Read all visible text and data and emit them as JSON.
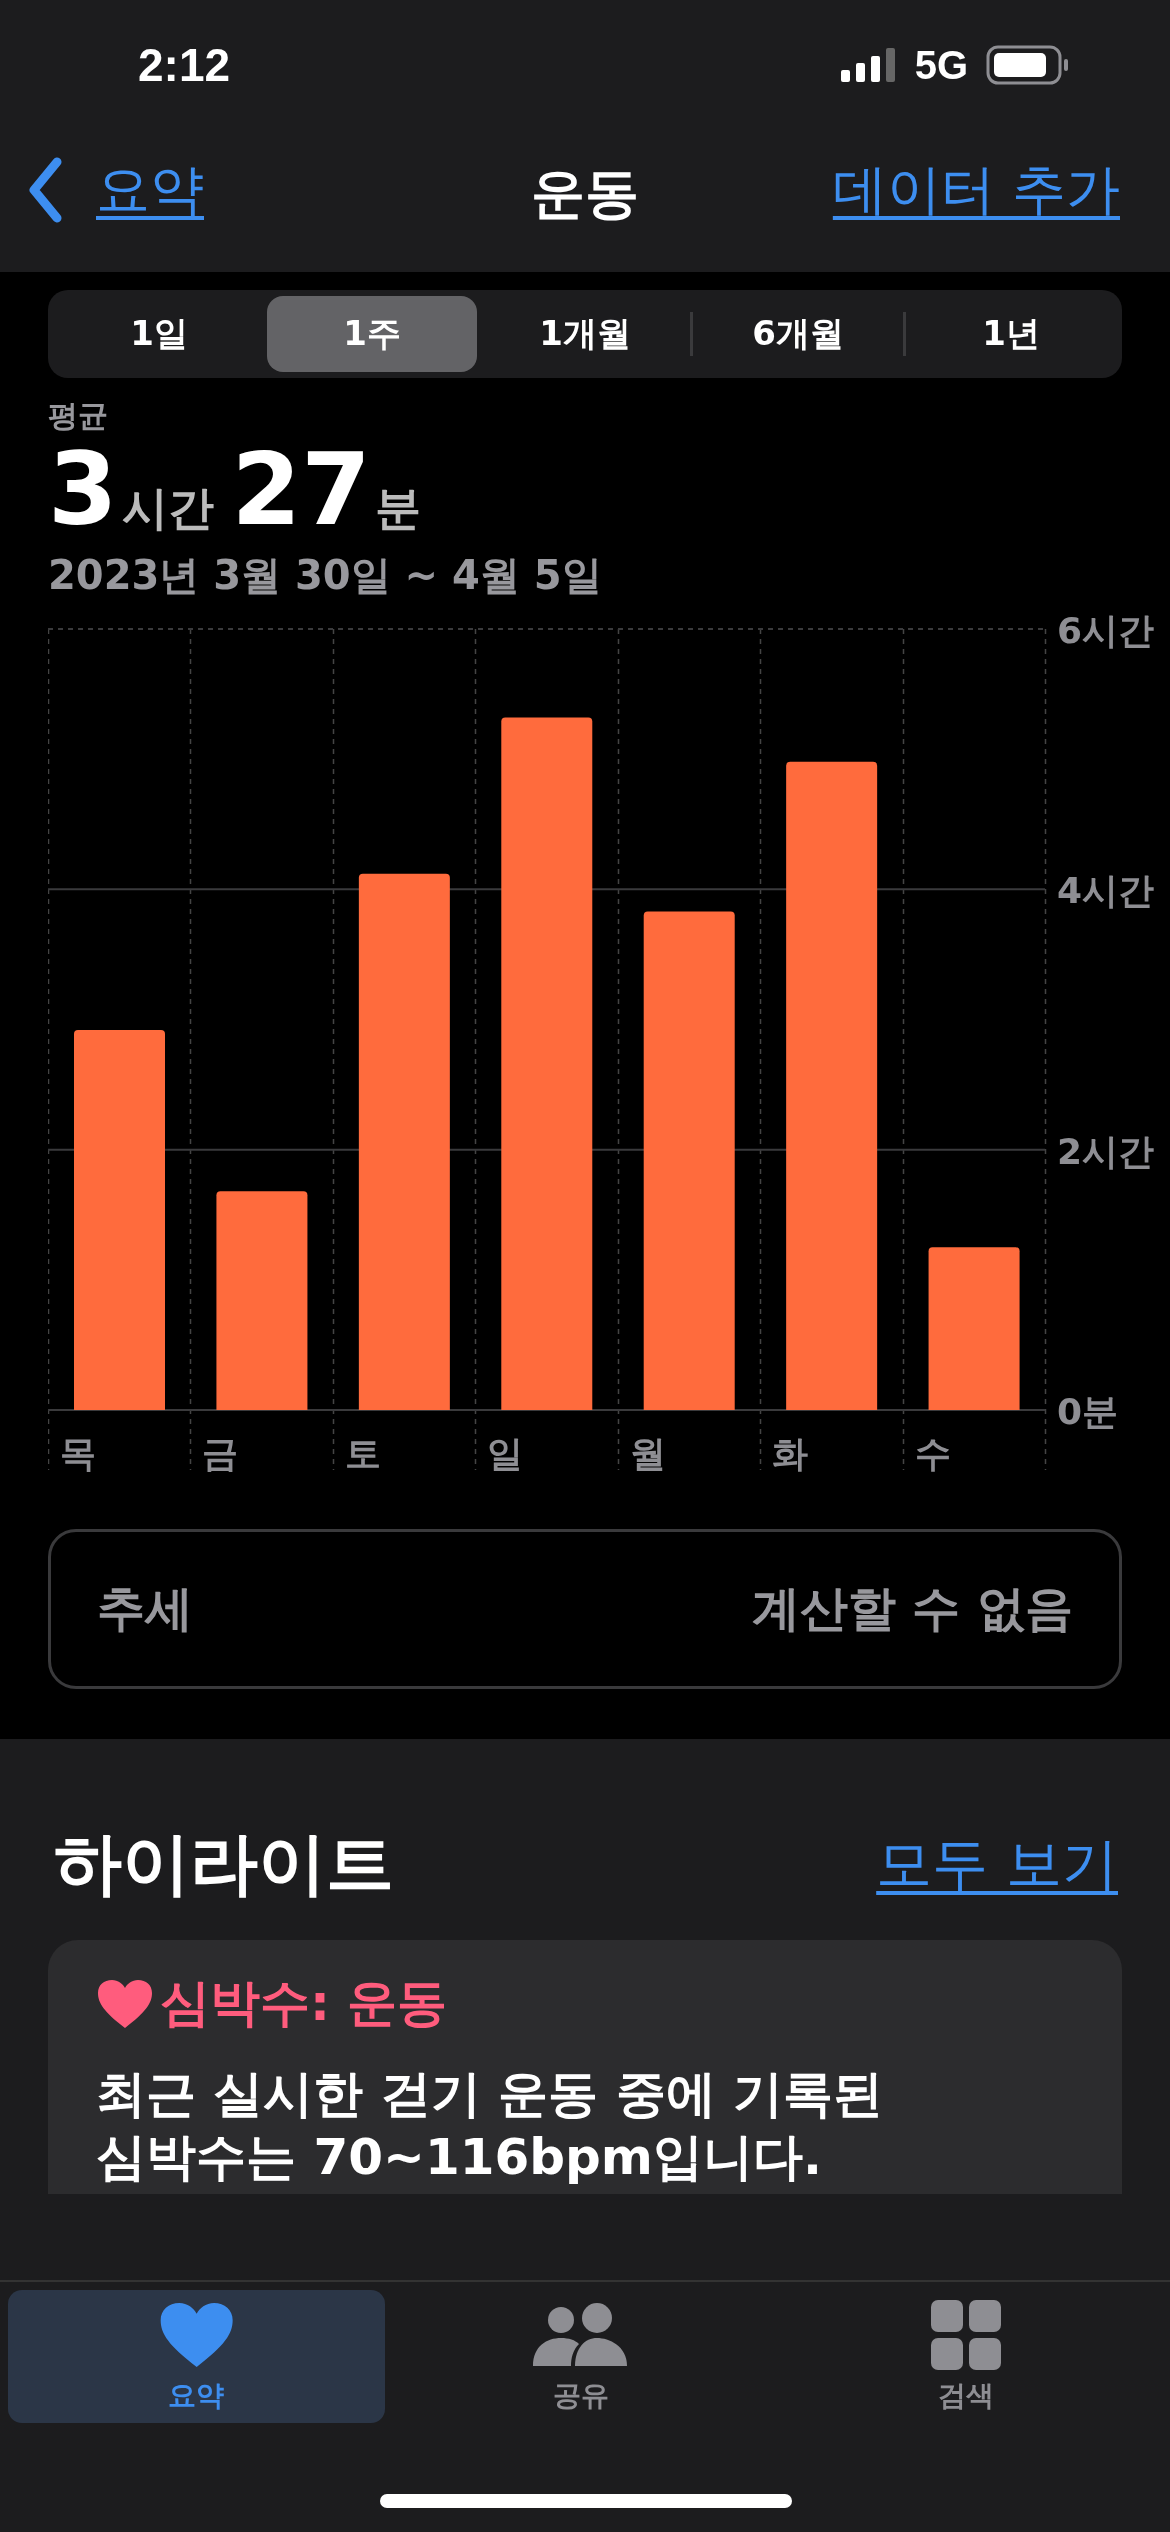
{
  "status_bar": {
    "time": "2:12",
    "network": "5G"
  },
  "nav": {
    "back": "요약",
    "title": "운동",
    "action": "데이터 추가"
  },
  "segments": [
    {
      "label": "1일",
      "selected": false
    },
    {
      "label": "1주",
      "selected": true
    },
    {
      "label": "1개월",
      "selected": false
    },
    {
      "label": "6개월",
      "selected": false
    },
    {
      "label": "1년",
      "selected": false
    }
  ],
  "summary": {
    "label": "평균",
    "parts": [
      {
        "number": "3",
        "unit": "시간"
      },
      {
        "number": "27",
        "unit": "분"
      }
    ],
    "date_range": "2023년 3월 30일 ~ 4월 5일"
  },
  "chart_data": {
    "type": "bar",
    "categories": [
      "목",
      "금",
      "토",
      "일",
      "월",
      "화",
      "수"
    ],
    "values": [
      2.92,
      1.68,
      4.12,
      5.32,
      3.83,
      4.98,
      1.25
    ],
    "ylim": [
      0,
      6
    ],
    "yticks": [
      {
        "value": 0,
        "label": "0분"
      },
      {
        "value": 2,
        "label": "2시간"
      },
      {
        "value": 4,
        "label": "4시간"
      },
      {
        "value": 6,
        "label": "6시간"
      }
    ]
  },
  "trend": {
    "label": "추세",
    "value": "계산할 수 없음"
  },
  "highlights": {
    "title": "하이라이트",
    "link": "모두 보기",
    "cards": [
      {
        "title": "심박수: 운동",
        "body": "최근 실시한 걷기 운동 중에 기록된 심박수는 **70~116bpm**입니다."
      }
    ]
  },
  "tab_bar": [
    {
      "kind": "heart",
      "label": "요약",
      "selected": true
    },
    {
      "kind": "people",
      "label": "공유",
      "selected": false
    },
    {
      "kind": "grid",
      "label": "검색",
      "selected": false
    }
  ]
}
